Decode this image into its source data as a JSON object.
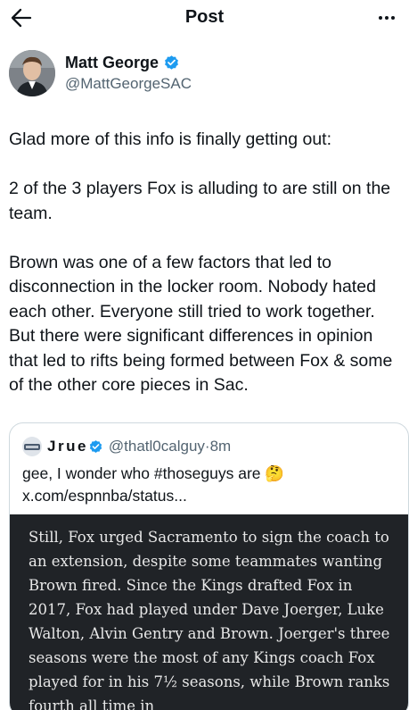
{
  "header": {
    "title": "Post"
  },
  "author": {
    "name": "Matt George",
    "handle": "@MattGeorgeSAC"
  },
  "post": {
    "paragraphs": [
      "Glad more of this info is finally getting out:",
      "2 of the 3 players Fox is alluding to are still on the team.",
      "Brown was one of a few factors that led to disconnection in the locker room. Nobody hated each other. Everyone still tried to work together. But there were significant differences in opinion that led to rifts being formed between Fox & some of the other core pieces in Sac."
    ]
  },
  "quote": {
    "name": "Jrue",
    "handle": "@thatl0calguy",
    "time": "8m",
    "separator": "·",
    "text": "gee, I wonder who #thoseguys are 🤔 x.com/espnnba/status...",
    "media_text": "Still, Fox urged Sacramento to sign the coach to an extension, despite some teammates wanting Brown fired. Since the Kings drafted Fox in 2017, Fox had played under Dave Joerger, Luke Walton, Alvin Gentry and Brown. Joerger's three seasons were the most of any Kings coach Fox played for in his 7½ seasons, while Brown ranks fourth all time in"
  },
  "icons": {
    "back": "arrow-left-icon",
    "more": "more-horizontal-icon",
    "verified": "verified-badge-icon"
  },
  "colors": {
    "text": "#0f1419",
    "secondary": "#536471",
    "verified": "#1d9bf0",
    "border": "#cfd9de",
    "media_bg": "#202327"
  }
}
